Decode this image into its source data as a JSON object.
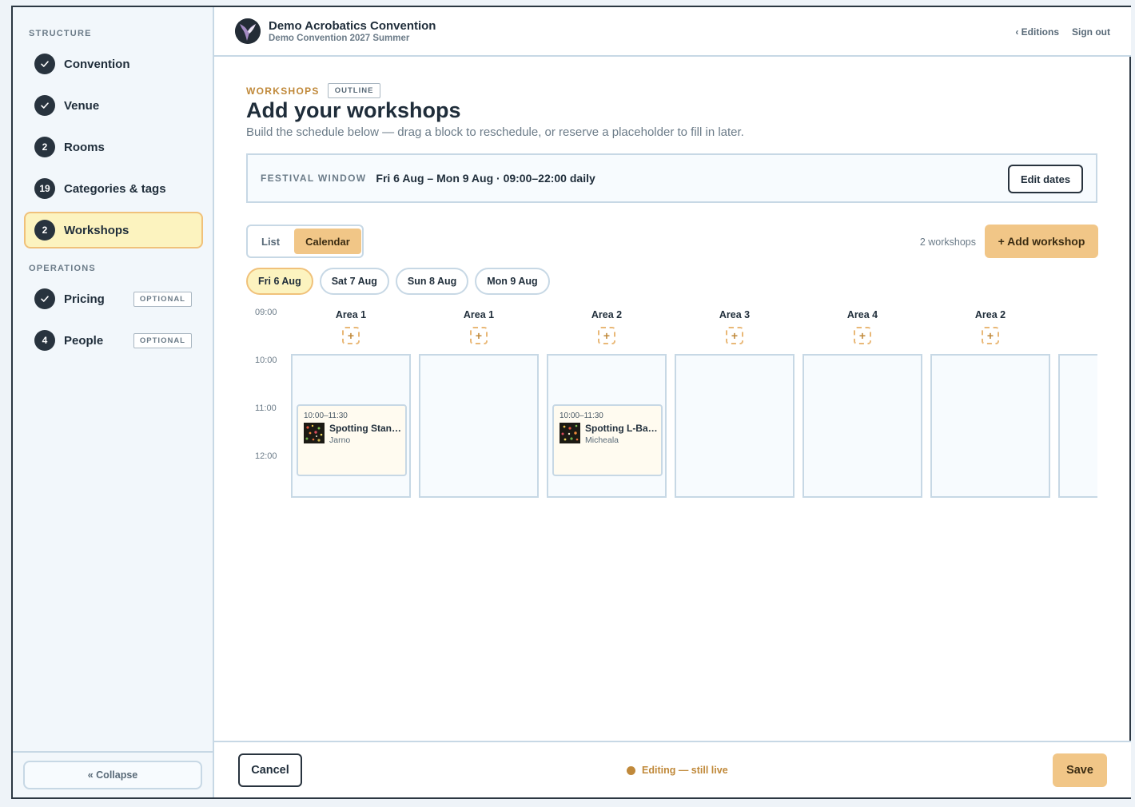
{
  "header": {
    "title": "Demo Acrobatics Convention",
    "subtitle": "Demo Convention 2027 Summer",
    "editions_link": "‹ Editions",
    "signout_link": "Sign out"
  },
  "sidebar": {
    "structure_label": "STRUCTURE",
    "operations_label": "OPERATIONS",
    "items": [
      {
        "label": "Convention",
        "badge": "",
        "icon": "check-icon"
      },
      {
        "label": "Venue",
        "badge": "",
        "icon": "check-icon"
      },
      {
        "label": "Rooms",
        "badge": "2"
      },
      {
        "label": "Categories & tags",
        "badge": "19"
      },
      {
        "label": "Workshops",
        "badge": "2",
        "active": true
      },
      {
        "label": "Pricing",
        "badge": "",
        "icon": "check-icon",
        "tag": "OPTIONAL"
      },
      {
        "label": "People",
        "badge": "4",
        "tag": "OPTIONAL"
      }
    ],
    "collapse_label": "«  Collapse"
  },
  "main": {
    "eyebrow": "WORKSHOPS",
    "eyebrow_tag": "OUTLINE",
    "title": "Add your workshops",
    "subtitle": "Build the schedule below — drag a block to reschedule, or reserve a placeholder to fill in later.",
    "festival_label": "FESTIVAL WINDOW",
    "festival_value": "Fri 6 Aug – Mon 9 Aug · 09:00–22:00 daily",
    "edit_dates": "Edit dates",
    "views": [
      "List",
      "Calendar"
    ],
    "active_view": "Calendar",
    "workshop_count": "2 workshops",
    "add_workshop": "+ Add workshop",
    "days": [
      "Fri 6 Aug",
      "Sat 7 Aug",
      "Sun 8 Aug",
      "Mon 9 Aug"
    ],
    "active_day": "Fri 6 Aug"
  },
  "calendar": {
    "times": [
      "09:00",
      "10:00",
      "11:00",
      "12:00"
    ],
    "add_symbol": "+",
    "columns": [
      {
        "name": "Area 1",
        "workshop": {
          "time": "10:00–11:30",
          "title": "Spotting Standing",
          "person": "Jarno"
        }
      },
      {
        "name": "Area 1"
      },
      {
        "name": "Area 2",
        "workshop": {
          "time": "10:00–11:30",
          "title": "Spotting L-Basing",
          "person": "Micheala"
        }
      },
      {
        "name": "Area 3"
      },
      {
        "name": "Area 4"
      },
      {
        "name": "Area 2"
      },
      {
        "name": ""
      }
    ]
  },
  "footer": {
    "cancel": "Cancel",
    "status": "Editing — still live",
    "save": "Save"
  },
  "colors": {
    "accent": "#f1c687",
    "accent_text": "#c0893a",
    "active_bg": "#fcf3bf",
    "dark": "#28333e",
    "border": "#c7d8e5"
  }
}
